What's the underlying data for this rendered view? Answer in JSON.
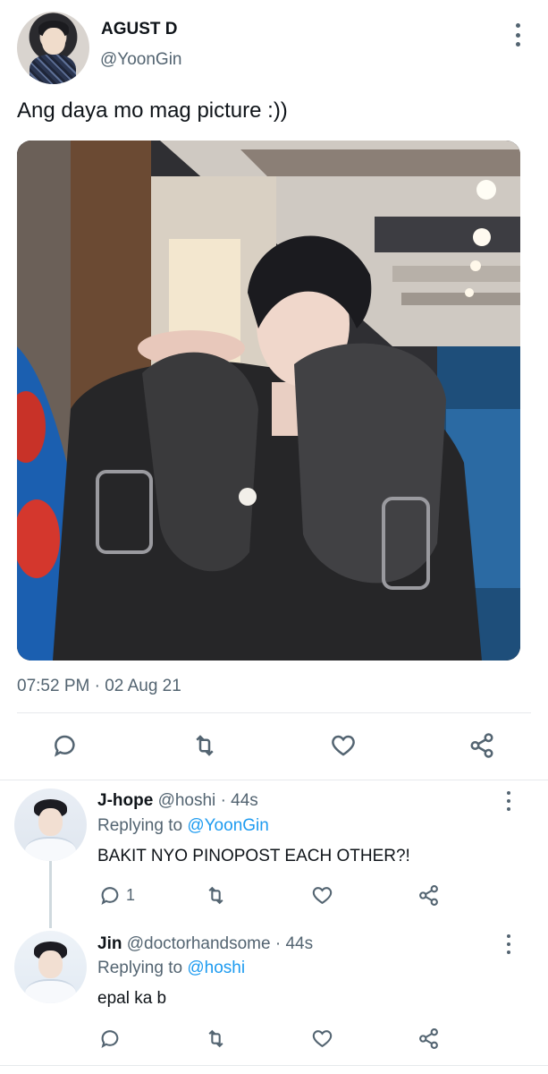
{
  "tweet": {
    "display_name": "AGUST D",
    "handle": "@YoonGin",
    "text": "Ang daya mo mag picture :))",
    "timestamp": "07:52 PM · 02 Aug 21",
    "icons": {
      "avatar": "user-avatar",
      "more": "more-vertical-icon",
      "reply": "comment-bubble-icon",
      "retweet": "retweet-icon",
      "like": "heart-icon",
      "share": "share-icon"
    }
  },
  "replies": [
    {
      "name": "J-hope",
      "handle": "@hoshi",
      "time": "· 44s",
      "replying_prefix": "Replying to",
      "replying_to": "@YoonGin",
      "text": "BAKIT NYO PINOPOST EACH OTHER?!",
      "reply_count": "1"
    },
    {
      "name": "Jin",
      "handle": "@doctorhandsome",
      "time": "· 44s",
      "replying_prefix": "Replying to",
      "replying_to": "@hoshi",
      "text": "epal ka b",
      "reply_count": ""
    }
  ],
  "colors": {
    "text_primary": "#0f1419",
    "text_secondary": "#536471",
    "link": "#1d9bf0",
    "divider": "#e6e9ec"
  }
}
